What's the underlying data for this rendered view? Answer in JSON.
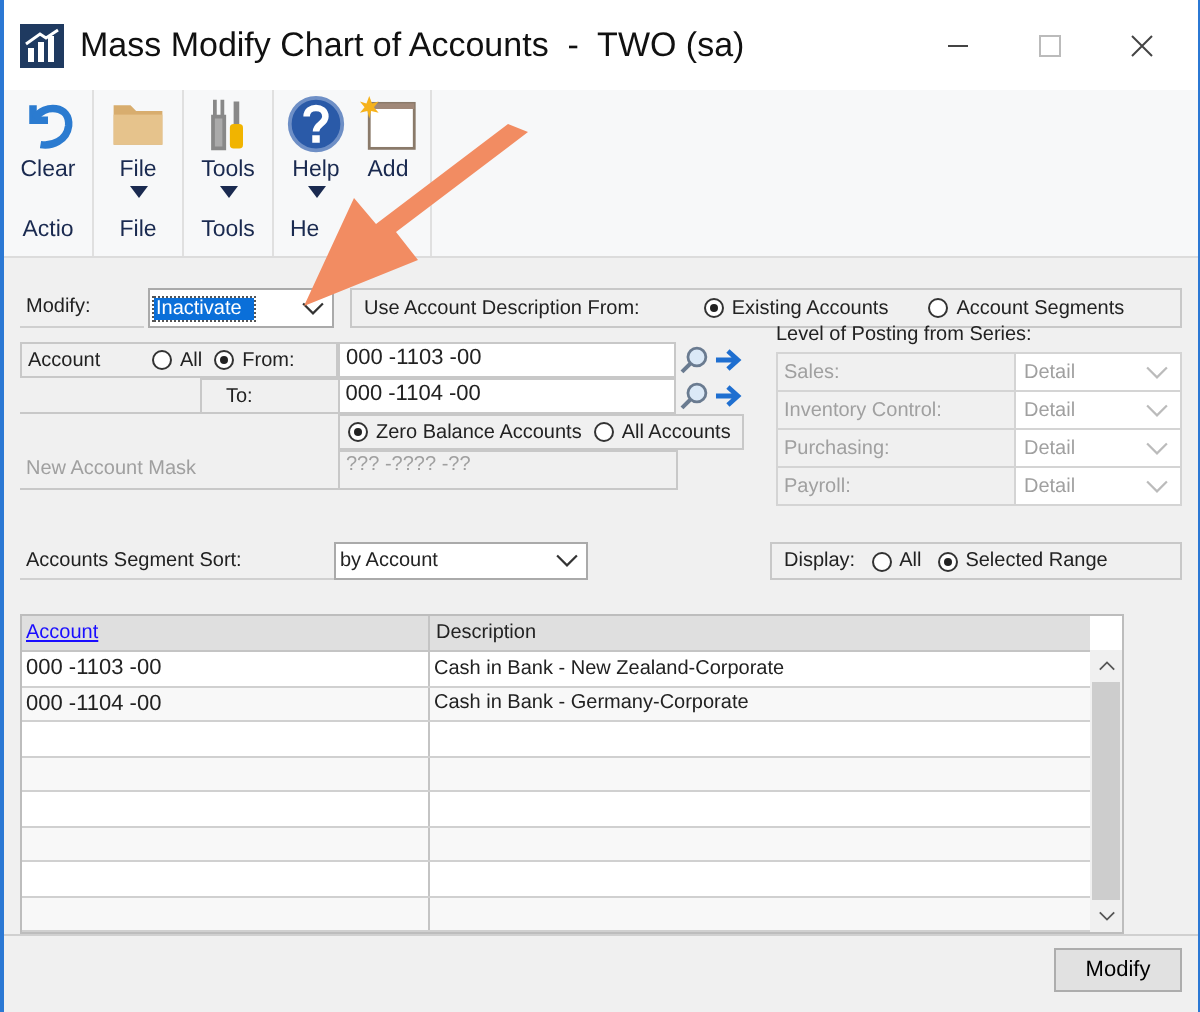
{
  "window": {
    "title": "Mass Modify Chart of Accounts  -  TWO (sa)"
  },
  "ribbon": {
    "groups": [
      {
        "label": "Actio",
        "buttons": [
          {
            "label": "Clear",
            "kind": "undo",
            "dropdown": false
          }
        ]
      },
      {
        "label": "File",
        "buttons": [
          {
            "label": "File",
            "kind": "folder",
            "dropdown": true
          }
        ]
      },
      {
        "label": "Tools",
        "buttons": [
          {
            "label": "Tools",
            "kind": "tools",
            "dropdown": true
          }
        ]
      },
      {
        "label": "He",
        "buttons": [
          {
            "label": "Help",
            "kind": "help",
            "dropdown": true
          },
          {
            "label": "Add",
            "kind": "note",
            "dropdown": false
          }
        ]
      }
    ]
  },
  "modify": {
    "label": "Modify:",
    "value": "Inactivate"
  },
  "description_from": {
    "label": "Use Account Description From:",
    "options": [
      {
        "label": "Existing Accounts",
        "selected": true
      },
      {
        "label": "Account Segments",
        "selected": false
      }
    ]
  },
  "account": {
    "label": "Account",
    "range_options": [
      {
        "label": "All",
        "selected": false
      },
      {
        "label": "From:",
        "selected": true
      }
    ],
    "from": "000 -1103 -00",
    "to_label": "To:",
    "to": "000 -1104 -00",
    "balance_options": [
      {
        "label": "Zero Balance Accounts",
        "selected": true
      },
      {
        "label": "All Accounts",
        "selected": false
      }
    ],
    "mask_label": "New Account Mask",
    "mask": "??? -???? -??",
    "mask_disabled": true
  },
  "posting": {
    "title": "Level of Posting from Series:",
    "disabled": true,
    "rows": [
      {
        "label": "Sales:",
        "value": "Detail"
      },
      {
        "label": "Inventory Control:",
        "value": "Detail"
      },
      {
        "label": "Purchasing:",
        "value": "Detail"
      },
      {
        "label": "Payroll:",
        "value": "Detail"
      }
    ]
  },
  "segment_sort": {
    "label": "Accounts Segment Sort:",
    "value": "by Account"
  },
  "display": {
    "label": "Display:",
    "options": [
      {
        "label": "All",
        "selected": false
      },
      {
        "label": "Selected Range",
        "selected": true
      }
    ]
  },
  "table": {
    "columns": [
      "Account",
      "Description"
    ],
    "rows": [
      [
        "000 -1103 -00",
        "Cash in Bank - New Zealand-Corporate"
      ],
      [
        "000 -1104 -00",
        "Cash in Bank - Germany-Corporate"
      ]
    ]
  },
  "buttons": [
    "Modify"
  ]
}
